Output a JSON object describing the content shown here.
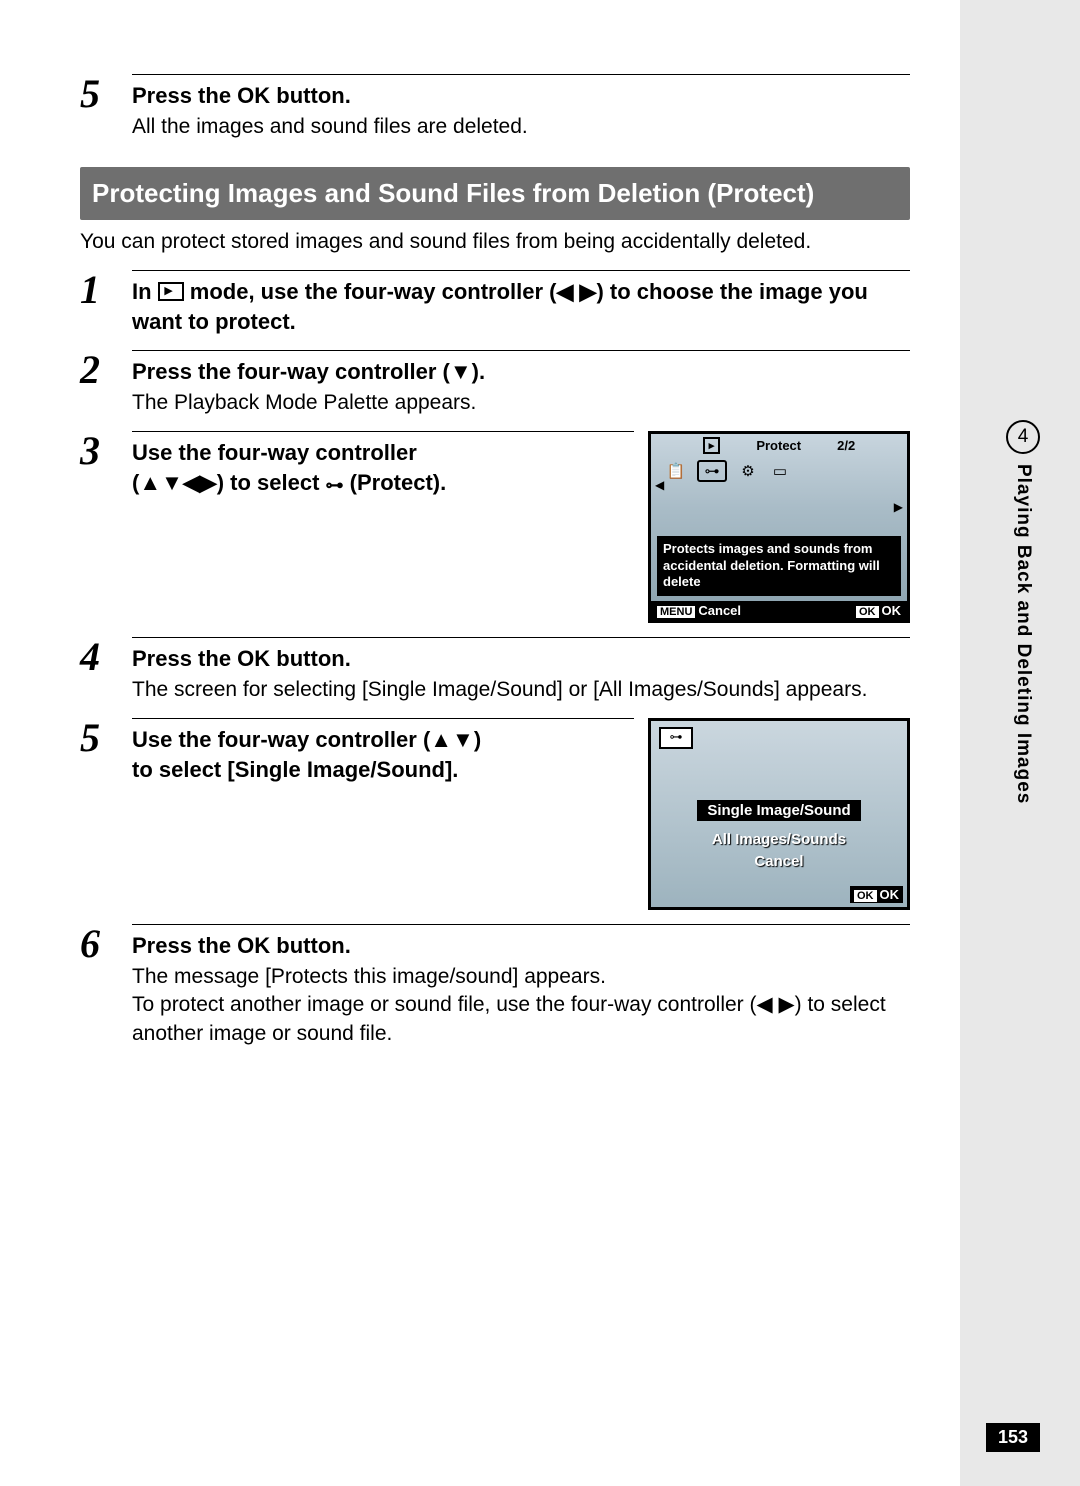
{
  "chapter": {
    "number": "4",
    "title": "Playing Back and Deleting Images"
  },
  "pageNumber": "153",
  "stepA": {
    "num": "5",
    "heading_pre": "Press the ",
    "heading_ok": "OK",
    "heading_post": " button.",
    "desc": "All the images and sound files are deleted."
  },
  "section": {
    "title": "Protecting Images and Sound Files from Deletion (Protect)",
    "intro": "You can protect stored images and sound files from being accidentally deleted."
  },
  "steps": {
    "s1": {
      "num": "1",
      "heading_pre": "In ",
      "heading_mid": " mode, use the four-way controller (◀ ▶) to choose the image you want to protect."
    },
    "s2": {
      "num": "2",
      "heading": "Press the four-way controller (▼).",
      "desc": "The Playback Mode Palette appears."
    },
    "s3": {
      "num": "3",
      "heading_l1": "Use the four-way controller",
      "heading_l2_pre": "(▲▼◀▶) to select ",
      "heading_l2_post": " (Protect)."
    },
    "s4": {
      "num": "4",
      "heading_pre": "Press the ",
      "heading_ok": "OK",
      "heading_post": " button.",
      "desc": "The screen for selecting [Single Image/Sound] or [All Images/Sounds] appears."
    },
    "s5": {
      "num": "5",
      "heading_l1": "Use the four-way controller (▲▼)",
      "heading_l2": "to select [Single Image/Sound]."
    },
    "s6": {
      "num": "6",
      "heading_pre": "Press the ",
      "heading_ok": "OK",
      "heading_post": " button.",
      "desc": "The message [Protects this image/sound] appears.\nTo protect another image or sound file, use the four-way controller (◀ ▶) to select another image or sound file."
    }
  },
  "screen1": {
    "title": "Protect",
    "page": "2/2",
    "icons": [
      "📋",
      "⊶",
      "⚙",
      "▭"
    ],
    "msg": "Protects images and sounds from accidental deletion. Formatting will delete",
    "menuLabel": "MENU",
    "cancel": "Cancel",
    "okLabel": "OK",
    "ok": "OK"
  },
  "screen2": {
    "lock": "⊶",
    "opt1": "Single Image/Sound",
    "opt2": "All Images/Sounds",
    "opt3": "Cancel",
    "okLabel": "OK",
    "ok": "OK"
  }
}
